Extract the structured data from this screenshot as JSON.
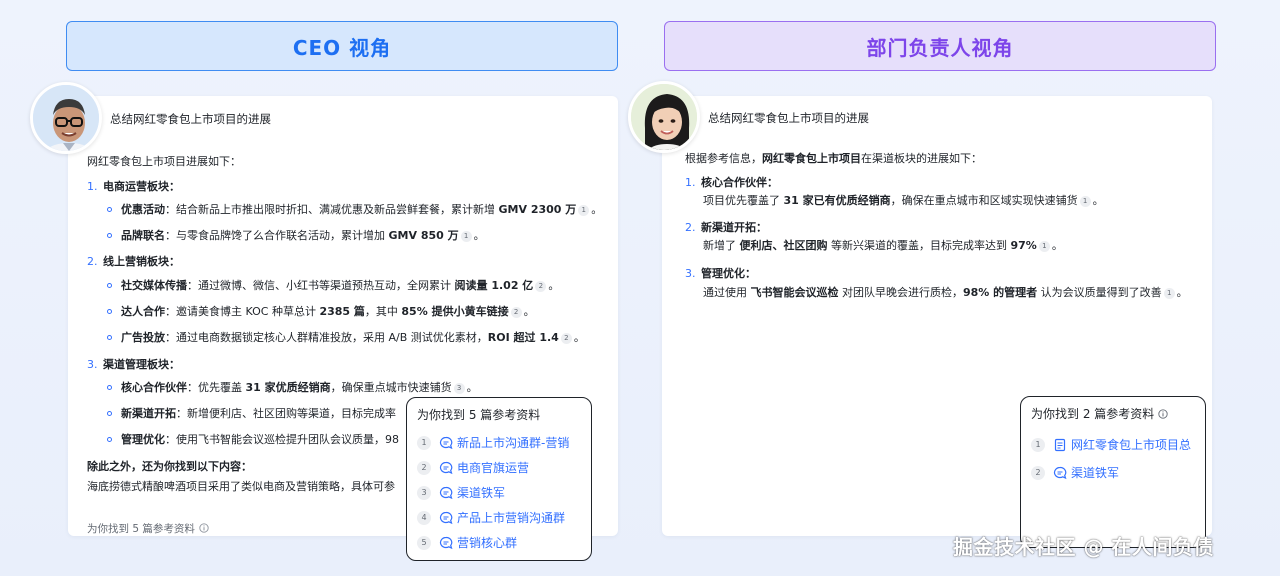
{
  "headers": {
    "left": "CEO 视角",
    "right": "部门负责人视角"
  },
  "left": {
    "question": "总结网红零食包上市项目的进展",
    "intro": "网红零食包上市项目进展如下：",
    "s1": {
      "num": "1.",
      "title": "电商运营板块：",
      "i1": {
        "label": "优惠活动",
        "text": "：结合新品上市推出限时折扣、满减优惠及新品尝鲜套餐，累计新增 ",
        "bold": "GMV 2300 万",
        "cite": "1",
        "end": "。"
      },
      "i2": {
        "label": "品牌联名",
        "text": "：与零食品牌馋了么合作联名活动，累计增加 ",
        "bold": "GMV 850 万",
        "cite": "1",
        "end": "。"
      }
    },
    "s2": {
      "num": "2.",
      "title": "线上营销板块：",
      "i1": {
        "label": "社交媒体传播",
        "text": "：通过微博、微信、小红书等渠道预热互动，全网累计 ",
        "bold": "阅读量 1.02 亿",
        "cite": "2",
        "end": "。"
      },
      "i2": {
        "label": "达人合作",
        "text": "：邀请美食博主 KOC 种草总计 ",
        "bold": "2385 篇",
        "mid": "，其中 ",
        "bold2": "85% 提供小黄车链接",
        "cite": "2",
        "end": "。"
      },
      "i3": {
        "label": "广告投放",
        "text": "：通过电商数据锁定核心人群精准投放，采用 A/B 测试优化素材，",
        "bold": "ROI 超过 1.4",
        "cite": "2",
        "end": "。"
      }
    },
    "s3": {
      "num": "3.",
      "title": "渠道管理板块：",
      "i1": {
        "label": "核心合作伙伴",
        "text": "：优先覆盖 ",
        "bold": "31 家优质经销商",
        "text2": "，确保重点城市快速铺货",
        "cite": "3",
        "end": "。"
      },
      "i2": {
        "label": "新渠道开拓",
        "text": "：新增便利店、社区团购等渠道，目标完成率"
      },
      "i3": {
        "label": "管理优化",
        "text": "：使用飞书智能会议巡检提升团队会议质量，98"
      }
    },
    "extra_title": "除此之外，还为你找到以下内容：",
    "extra_text": "海底捞德式精酿啤酒项目采用了类似电商及营销策略，具体可参",
    "footer": "为你找到 5 篇参考资料",
    "popover": {
      "title": "为你找到 5 篇参考资料",
      "items": [
        {
          "idx": "1",
          "label": "新品上市沟通群-营销",
          "icon": "chat-icon"
        },
        {
          "idx": "2",
          "label": "电商官旗运营",
          "icon": "chat-icon"
        },
        {
          "idx": "3",
          "label": "渠道铁军",
          "icon": "chat-icon"
        },
        {
          "idx": "4",
          "label": "产品上市营销沟通群",
          "icon": "chat-icon"
        },
        {
          "idx": "5",
          "label": "营销核心群",
          "icon": "chat-icon"
        }
      ]
    }
  },
  "right": {
    "question": "总结网红零食包上市项目的进展",
    "intro_pre": "根据参考信息，",
    "intro_bold": "网红零食包上市项目",
    "intro_post": "在渠道板块的进展如下：",
    "s1": {
      "num": "1.",
      "title": "核心合作伙伴：",
      "text": "项目优先覆盖了 ",
      "bold": "31 家已有优质经销商",
      "text2": "，确保在重点城市和区域实现快速铺货",
      "cite": "1",
      "end": "。"
    },
    "s2": {
      "num": "2.",
      "title": "新渠道开拓：",
      "text": "新增了 ",
      "bold": "便利店、社区团购",
      "text2": " 等新兴渠道的覆盖，目标完成率达到 ",
      "bold2": "97%",
      "cite": "1",
      "end": "。"
    },
    "s3": {
      "num": "3.",
      "title": "管理优化：",
      "text": "通过使用 ",
      "bold": "飞书智能会议巡检",
      "text2": " 对团队早晚会进行质检，",
      "bold2": "98% 的管理者",
      "text3": " 认为会议质量得到了改善",
      "cite": "1",
      "end": "。"
    },
    "popover": {
      "title": "为你找到 2 篇参考资料",
      "items": [
        {
          "idx": "1",
          "label": "网红零食包上市项目总",
          "icon": "doc-icon"
        },
        {
          "idx": "2",
          "label": "渠道铁军",
          "icon": "chat-icon"
        }
      ]
    }
  },
  "watermark": "掘金技术社区 @ 在人间负债"
}
